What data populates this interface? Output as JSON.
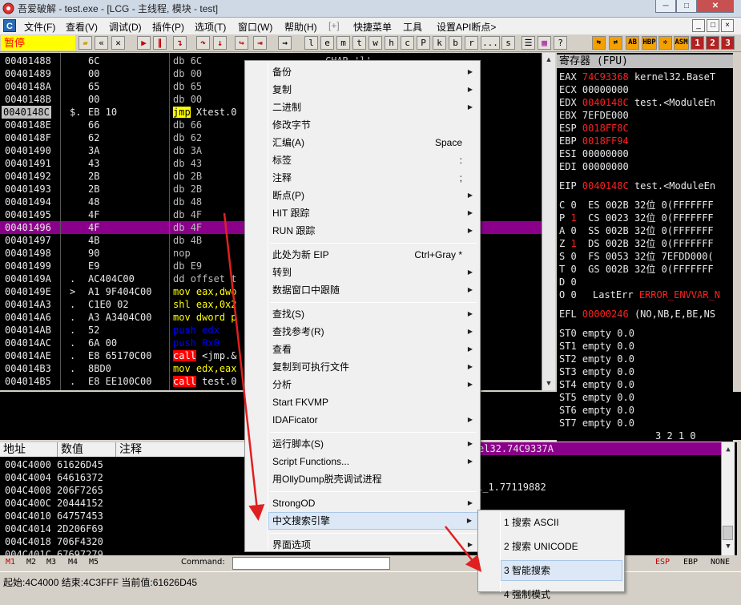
{
  "window": {
    "title": "吾爱破解 - test.exe - [LCG - 主线程, 模块 - test]",
    "controls": [
      "minimize",
      "maximize",
      "close"
    ]
  },
  "menubar": {
    "app_icon": "C",
    "items": [
      "文件(F)",
      "查看(V)",
      "调试(D)",
      "插件(P)",
      "选项(T)",
      "窗口(W)",
      "帮助(H)",
      "[+]",
      "快捷菜单",
      "工具",
      "设置API断点>"
    ],
    "mdi_controls": [
      "_",
      "□",
      "×"
    ]
  },
  "toolbar": {
    "status": "暂停",
    "buttons": [
      "open-icon",
      "restart-icon",
      "close-icon",
      "run-icon",
      "pause-icon",
      "step-into-icon",
      "step-over-icon",
      "trace-into-icon",
      "trace-over-icon",
      "execute-till-return-icon",
      "goto-icon"
    ],
    "letters": [
      "l",
      "e",
      "m",
      "t",
      "w",
      "h",
      "c",
      "P",
      "k",
      "b",
      "r",
      "...",
      "s"
    ],
    "right_buttons": [
      "HBP",
      "ASM",
      "1",
      "2",
      "3"
    ]
  },
  "disassembly": {
    "rows": [
      {
        "addr": "00401488",
        "mark": "",
        "hex": "6C",
        "mnem": "db",
        "ops": "6C",
        "cmt": "CHAR 'l'",
        "type": "db"
      },
      {
        "addr": "00401489",
        "mark": "",
        "hex": "00",
        "mnem": "db",
        "ops": "00",
        "cmt": "",
        "type": "db"
      },
      {
        "addr": "0040148A",
        "mark": "",
        "hex": "65",
        "mnem": "db",
        "ops": "65",
        "cmt": "",
        "type": "db"
      },
      {
        "addr": "0040148B",
        "mark": "",
        "hex": "00",
        "mnem": "db",
        "ops": "00",
        "cmt": "",
        "type": "db"
      },
      {
        "addr": "0040148C",
        "mark": "$.",
        "hex": "EB 10",
        "mnem": "jmp",
        "ops": "Xtest.0",
        "cmt": "",
        "type": "jmp",
        "addr_hl": true
      },
      {
        "addr": "0040148E",
        "mark": "",
        "hex": "66",
        "mnem": "db",
        "ops": "66",
        "cmt": "",
        "type": "db"
      },
      {
        "addr": "0040148F",
        "mark": "",
        "hex": "62",
        "mnem": "db",
        "ops": "62",
        "cmt": "",
        "type": "db"
      },
      {
        "addr": "00401490",
        "mark": "",
        "hex": "3A",
        "mnem": "db",
        "ops": "3A",
        "cmt": "",
        "type": "db"
      },
      {
        "addr": "00401491",
        "mark": "",
        "hex": "43",
        "mnem": "db",
        "ops": "43",
        "cmt": "",
        "type": "db"
      },
      {
        "addr": "00401492",
        "mark": "",
        "hex": "2B",
        "mnem": "db",
        "ops": "2B",
        "cmt": "",
        "type": "db"
      },
      {
        "addr": "00401493",
        "mark": "",
        "hex": "2B",
        "mnem": "db",
        "ops": "2B",
        "cmt": "",
        "type": "db"
      },
      {
        "addr": "00401494",
        "mark": "",
        "hex": "48",
        "mnem": "db",
        "ops": "48",
        "cmt": "",
        "type": "db"
      },
      {
        "addr": "00401495",
        "mark": "",
        "hex": "4F",
        "mnem": "db",
        "ops": "4F",
        "cmt": "",
        "type": "db"
      },
      {
        "addr": "00401496",
        "mark": "",
        "hex": "4F",
        "mnem": "db",
        "ops": "4F",
        "cmt": "",
        "type": "db",
        "selected": true
      },
      {
        "addr": "00401497",
        "mark": "",
        "hex": "4B",
        "mnem": "db",
        "ops": "4B",
        "cmt": "",
        "type": "db"
      },
      {
        "addr": "00401498",
        "mark": "",
        "hex": "90",
        "mnem": "nop",
        "ops": "",
        "cmt": "",
        "type": "db"
      },
      {
        "addr": "00401499",
        "mark": "",
        "hex": "E9",
        "mnem": "db",
        "ops": "E9",
        "cmt": "",
        "type": "db"
      },
      {
        "addr": "0040149A",
        "mark": ".",
        "hex": "AC404C00",
        "mnem": "dd",
        "ops": "offset t",
        "cmt": "",
        "type": "db"
      },
      {
        "addr": "0040149E",
        "mark": ">",
        "hex": "A1 9F404C00",
        "mnem": "mov",
        "ops": "eax,dwo",
        "cmt": "",
        "type": "mov"
      },
      {
        "addr": "004014A3",
        "mark": ".",
        "hex": "C1E0 02",
        "mnem": "shl",
        "ops": "eax,0x2",
        "cmt": "",
        "type": "shl"
      },
      {
        "addr": "004014A6",
        "mark": ".",
        "hex": "A3 A3404C00",
        "mnem": "mov",
        "ops": "dword p",
        "cmt": "",
        "type": "mov"
      },
      {
        "addr": "004014AB",
        "mark": ".",
        "hex": "52",
        "mnem": "push",
        "ops": "edx",
        "cmt": "",
        "type": "push"
      },
      {
        "addr": "004014AC",
        "mark": ".",
        "hex": "6A 00",
        "mnem": "push",
        "ops": "0x0",
        "cmt": "",
        "type": "push"
      },
      {
        "addr": "004014AE",
        "mark": ".",
        "hex": "E8 65170C00",
        "mnem": "call",
        "ops": "<jmp.&",
        "cmt": "",
        "type": "call"
      },
      {
        "addr": "004014B3",
        "mark": ".",
        "hex": "8BD0",
        "mnem": "mov",
        "ops": "edx,eax",
        "cmt": "",
        "type": "mov"
      },
      {
        "addr": "004014B5",
        "mark": ".",
        "hex": "E8 EE100C00",
        "mnem": "call",
        "ops": "test.0",
        "cmt": "",
        "type": "call"
      }
    ]
  },
  "registers": {
    "title": "寄存器 (FPU)",
    "gp": [
      {
        "name": "EAX",
        "val": "74C93368",
        "changed": true,
        "note": "kernel32.BaseT"
      },
      {
        "name": "ECX",
        "val": "00000000",
        "changed": false,
        "note": ""
      },
      {
        "name": "EDX",
        "val": "0040148C",
        "changed": true,
        "note": "test.<ModuleEn"
      },
      {
        "name": "EBX",
        "val": "7EFDE000",
        "changed": false,
        "note": ""
      },
      {
        "name": "ESP",
        "val": "0018FF8C",
        "changed": true,
        "note": ""
      },
      {
        "name": "EBP",
        "val": "0018FF94",
        "changed": true,
        "note": ""
      },
      {
        "name": "ESI",
        "val": "00000000",
        "changed": false,
        "note": ""
      },
      {
        "name": "EDI",
        "val": "00000000",
        "changed": false,
        "note": ""
      }
    ],
    "eip": {
      "name": "EIP",
      "val": "0040148C",
      "note": "test.<ModuleEn"
    },
    "flags": [
      {
        "f": "C",
        "v": "0",
        "changed": false,
        "seg": "ES 002B 32位 0(FFFFFFF"
      },
      {
        "f": "P",
        "v": "1",
        "changed": true,
        "seg": "CS 0023 32位 0(FFFFFFF"
      },
      {
        "f": "A",
        "v": "0",
        "changed": false,
        "seg": "SS 002B 32位 0(FFFFFFF"
      },
      {
        "f": "Z",
        "v": "1",
        "changed": true,
        "seg": "DS 002B 32位 0(FFFFFFF"
      },
      {
        "f": "S",
        "v": "0",
        "changed": false,
        "seg": "FS 0053 32位 7EFDD000("
      },
      {
        "f": "T",
        "v": "0",
        "changed": false,
        "seg": "GS 002B 32位 0(FFFFFFF"
      },
      {
        "f": "D",
        "v": "0",
        "changed": false,
        "seg": ""
      },
      {
        "f": "O",
        "v": "0",
        "changed": false,
        "seg": ""
      }
    ],
    "lasterr_label": "LastErr",
    "lasterr_val": "ERROR_ENVVAR_N",
    "efl_label": "EFL",
    "efl_val": "00000246",
    "efl_note": "(NO,NB,E,BE,NS",
    "st": [
      "ST0 empty 0.0",
      "ST1 empty 0.0",
      "ST2 empty 0.0",
      "ST3 empty 0.0",
      "ST4 empty 0.0",
      "ST5 empty 0.0",
      "ST6 empty 0.0",
      "ST7 empty 0.0"
    ],
    "fpu_bits": "3 2 1 0"
  },
  "dump": {
    "headers": [
      "地址",
      "数值",
      "注释"
    ],
    "rows": [
      {
        "addr": "004C4000",
        "val": "61626D45"
      },
      {
        "addr": "004C4004",
        "val": "64616372"
      },
      {
        "addr": "004C4008",
        "val": "206F7265"
      },
      {
        "addr": "004C400C",
        "val": "20444152"
      },
      {
        "addr": "004C4010",
        "val": "64757453"
      },
      {
        "addr": "004C4014",
        "val": "2D206F69"
      },
      {
        "addr": "004C4018",
        "val": "706F4320"
      },
      {
        "addr": "004C401C",
        "val": "67697279"
      }
    ]
  },
  "stack": {
    "highlight": "el32.74C9337A",
    "line2": "1_1.77119882"
  },
  "cmdbar": {
    "tabs": [
      "M1",
      "M2",
      "M3",
      "M4",
      "M5"
    ],
    "command_label": "Command:",
    "regs": [
      "ESP",
      "EBP",
      "NONE"
    ]
  },
  "status": {
    "text": "起始:4C4000 结束:4C3FFF 当前值:61626D45"
  },
  "context_menu": {
    "items": [
      {
        "label": "备份",
        "shortcut": "",
        "arrow": true
      },
      {
        "label": "复制",
        "shortcut": "",
        "arrow": true
      },
      {
        "label": "二进制",
        "shortcut": "",
        "arrow": true
      },
      {
        "label": "修改字节",
        "shortcut": "",
        "arrow": false
      },
      {
        "label": "汇编(A)",
        "shortcut": "Space",
        "arrow": false
      },
      {
        "label": "标签",
        "shortcut": ":",
        "arrow": false
      },
      {
        "label": "注释",
        "shortcut": ";",
        "arrow": false
      },
      {
        "label": "断点(P)",
        "shortcut": "",
        "arrow": true
      },
      {
        "label": "HIT 跟踪",
        "shortcut": "",
        "arrow": true
      },
      {
        "label": "RUN 跟踪",
        "shortcut": "",
        "arrow": true
      },
      {
        "sep": true
      },
      {
        "label": "此处为新 EIP",
        "shortcut": "Ctrl+Gray *",
        "arrow": false
      },
      {
        "label": "转到",
        "shortcut": "",
        "arrow": true
      },
      {
        "label": "数据窗口中跟随",
        "shortcut": "",
        "arrow": true
      },
      {
        "sep": true
      },
      {
        "label": "查找(S)",
        "shortcut": "",
        "arrow": true
      },
      {
        "label": "查找参考(R)",
        "shortcut": "",
        "arrow": true
      },
      {
        "label": "查看",
        "shortcut": "",
        "arrow": true
      },
      {
        "label": "复制到可执行文件",
        "shortcut": "",
        "arrow": true
      },
      {
        "label": "分析",
        "shortcut": "",
        "arrow": true
      },
      {
        "label": "Start FKVMP",
        "shortcut": "",
        "arrow": false
      },
      {
        "label": "IDAFicator",
        "shortcut": "",
        "arrow": true
      },
      {
        "sep": true
      },
      {
        "label": "运行脚本(S)",
        "shortcut": "",
        "arrow": true
      },
      {
        "label": "Script Functions...",
        "shortcut": "",
        "arrow": true
      },
      {
        "label": "用OllyDump脱壳调试进程",
        "shortcut": "",
        "arrow": false
      },
      {
        "sep": true
      },
      {
        "label": "StrongOD",
        "shortcut": "",
        "arrow": true
      },
      {
        "label": "中文搜索引擎",
        "shortcut": "",
        "arrow": true,
        "hover": true
      },
      {
        "sep": true
      },
      {
        "label": "界面选项",
        "shortcut": "",
        "arrow": true
      }
    ]
  },
  "submenu": {
    "items": [
      {
        "label": "1 搜索 ASCII",
        "hover": false
      },
      {
        "label": "2 搜索 UNICODE",
        "hover": false
      },
      {
        "label": "3 智能搜索",
        "hover": true
      },
      {
        "label": "4 强制模式",
        "hover": false
      }
    ]
  },
  "colors": {
    "annotation_arrow": "#e02020",
    "selection": "#8b008b",
    "changed_value": "#ff2020",
    "menu_hover": "#dde8f6"
  }
}
